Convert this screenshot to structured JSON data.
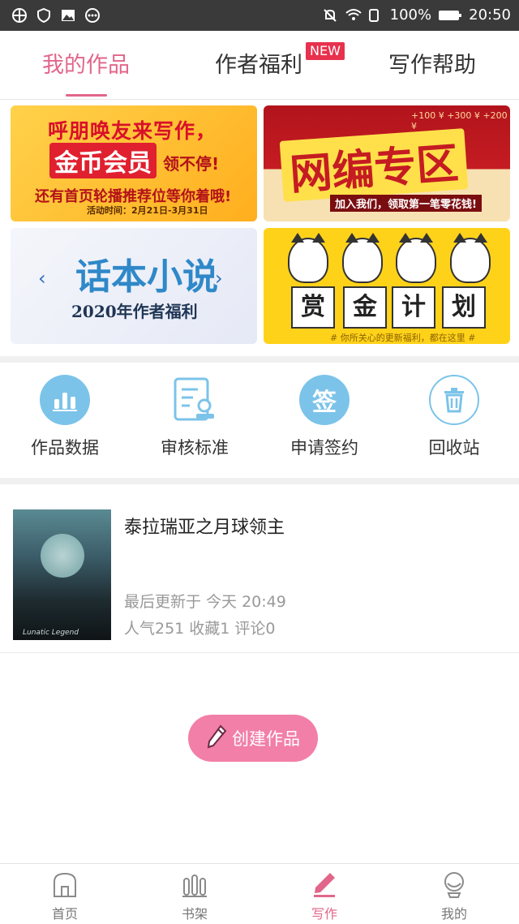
{
  "status_bar": {
    "battery_percent": "100%",
    "time": "20:50"
  },
  "tabs": [
    {
      "label": "我的作品",
      "active": true
    },
    {
      "label": "作者福利",
      "badge": "NEW"
    },
    {
      "label": "写作帮助"
    }
  ],
  "banners": {
    "b1": {
      "line1": "呼朋唤友来写作，",
      "line2": "金币会员",
      "line2b": "领不停!",
      "line3": "还有首页轮播推荐位等你着哦!",
      "date": "活动时间：2月21日-3月31日"
    },
    "b2": {
      "title": "网编专区",
      "sub": "加入我们，领取第一笔零花钱!",
      "coins": "+100 ¥  +300 ¥  +200 ¥"
    },
    "b3": {
      "title": "话本小说",
      "sub": "2020年作者福利"
    },
    "b4": {
      "words": [
        "赏",
        "金",
        "计",
        "划"
      ],
      "foot": "# 你所关心的更新福利，都在这里 #"
    }
  },
  "quick_menu": [
    {
      "label": "作品数据",
      "icon": "bar-chart-icon"
    },
    {
      "label": "审核标准",
      "icon": "review-doc-icon"
    },
    {
      "label": "申请签约",
      "icon": "sign-icon",
      "icon_text": "签"
    },
    {
      "label": "回收站",
      "icon": "trash-icon"
    }
  ],
  "work": {
    "title": "泰拉瑞亚之月球领主",
    "updated": "最后更新于 今天 20:49",
    "stats": "人气251  收藏1  评论0",
    "cover_text": "Lunatic Legend"
  },
  "create_button": {
    "label": "创建作品"
  },
  "bottom_nav": [
    {
      "label": "首页",
      "icon": "home-icon"
    },
    {
      "label": "书架",
      "icon": "bookshelf-icon"
    },
    {
      "label": "写作",
      "icon": "pen-icon",
      "active": true
    },
    {
      "label": "我的",
      "icon": "profile-icon"
    }
  ],
  "colors": {
    "accent": "#e2668a",
    "button": "#f27fa8",
    "icon_blue": "#7cc3ea"
  }
}
